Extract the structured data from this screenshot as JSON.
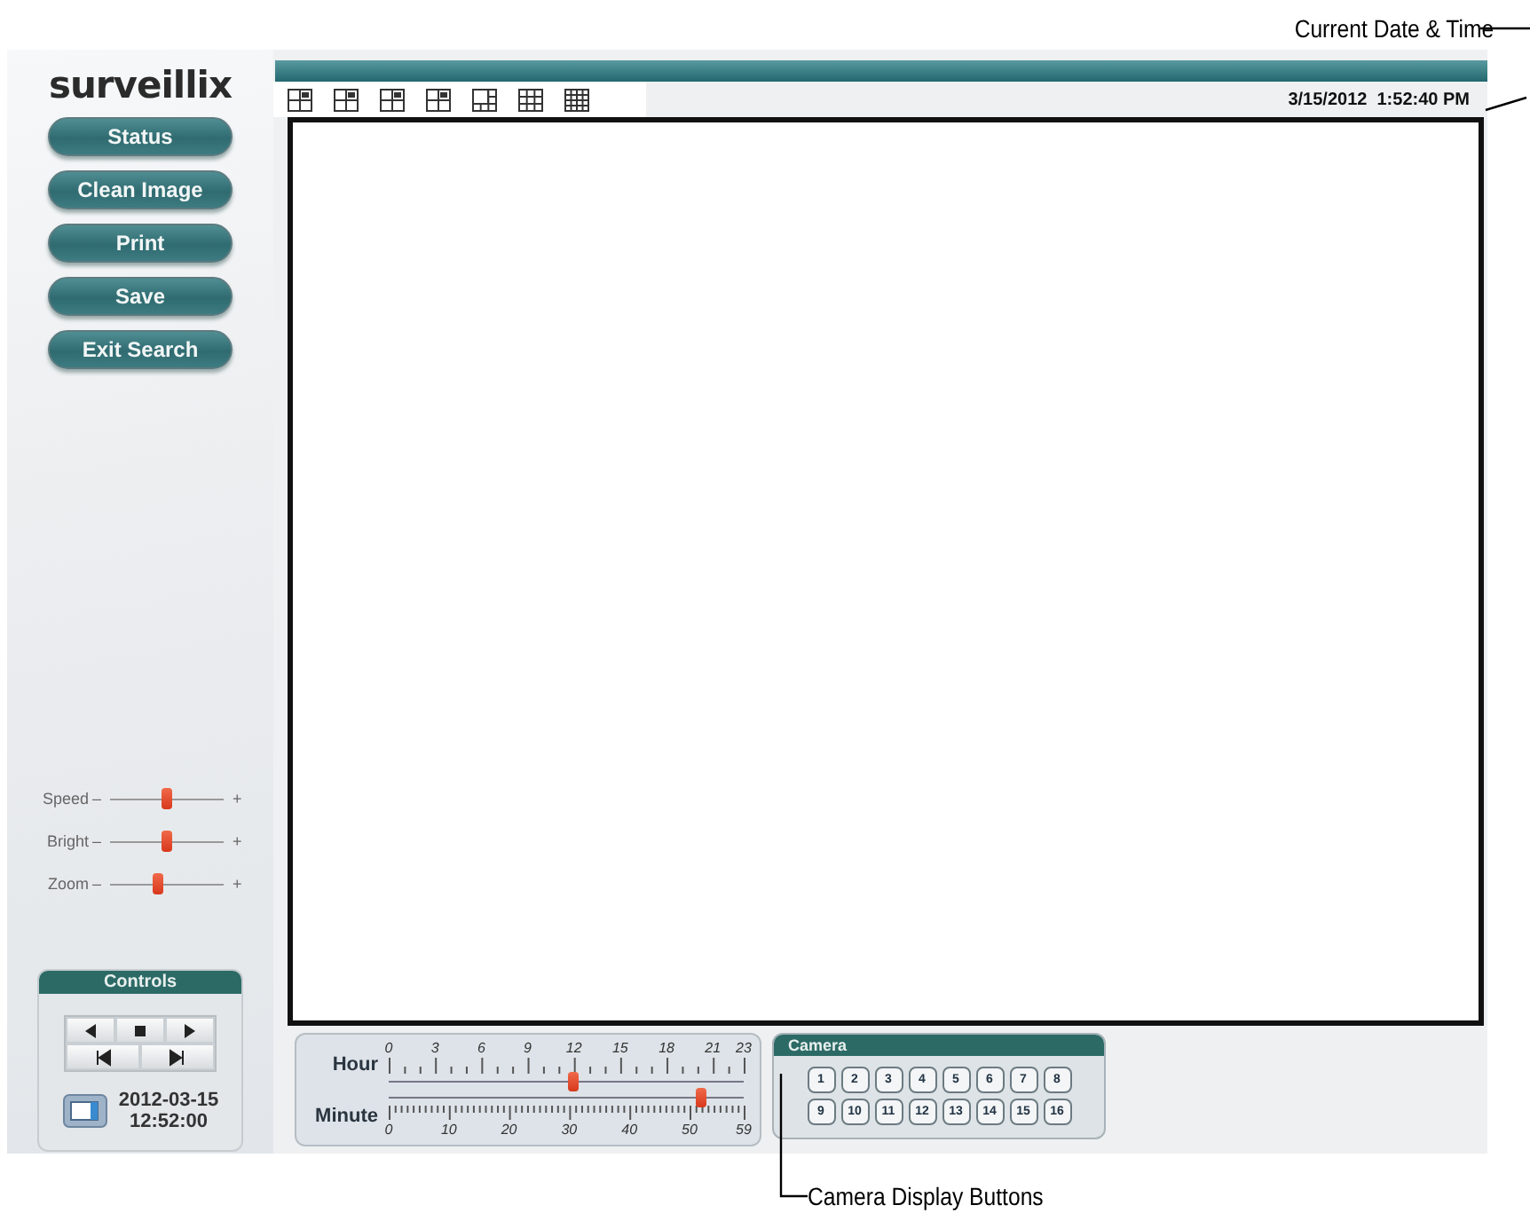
{
  "annotations": {
    "top": "Current Date & Time",
    "bottom": "Camera Display Buttons"
  },
  "sidebar": {
    "logo": "surveillix",
    "buttons": [
      "Status",
      "Clean Image",
      "Print",
      "Save",
      "Exit Search"
    ],
    "sliders": [
      {
        "label": "Speed",
        "minus": "–",
        "plus": "+",
        "level": 0.5
      },
      {
        "label": "Bright",
        "minus": "–",
        "plus": "+",
        "level": 0.5
      },
      {
        "label": "Zoom",
        "minus": "–",
        "plus": "+",
        "level": 0.42
      }
    ],
    "controls": {
      "title": "Controls",
      "buttons": [
        {
          "kind": "back"
        },
        {
          "kind": "stop"
        },
        {
          "kind": "play"
        },
        {
          "kind": "first"
        },
        {
          "kind": "last"
        }
      ],
      "date": "2012-03-15",
      "time": "12:52:00"
    }
  },
  "toolbar": {
    "layouts": [
      {
        "kind": "quad"
      },
      {
        "kind": "quad"
      },
      {
        "kind": "quad"
      },
      {
        "kind": "quad"
      },
      {
        "kind": "six"
      },
      {
        "kind": "nine"
      },
      {
        "kind": "sixteen"
      }
    ],
    "datetime": "3/15/2012  1:52:40 PM"
  },
  "timeline": {
    "sliders": [
      {
        "label": "Hour",
        "ticks": [
          "0",
          "3",
          "6",
          "9",
          "12",
          "15",
          "18",
          "21",
          "23"
        ],
        "level": 0.52
      },
      {
        "label": "Minute",
        "ticks": [
          "0",
          "10",
          "20",
          "30",
          "40",
          "50",
          "59"
        ],
        "level": 0.88
      }
    ]
  },
  "camera": {
    "title": "Camera",
    "buttons": [
      "1",
      "2",
      "3",
      "4",
      "5",
      "6",
      "7",
      "8",
      "9",
      "10",
      "11",
      "12",
      "13",
      "14",
      "15",
      "16"
    ]
  }
}
